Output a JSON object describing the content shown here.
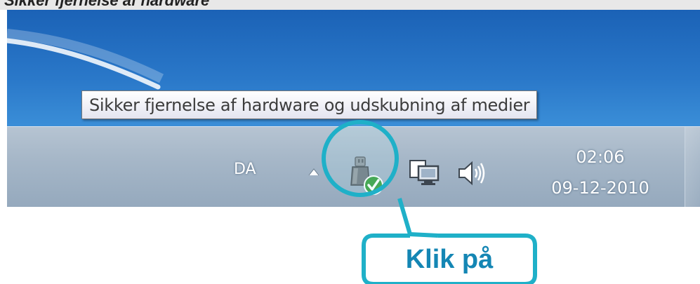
{
  "page_heading": "Sikker fjernelse af hardware",
  "tooltip": {
    "text": "Sikker fjernelse af hardware og udskubning af medier"
  },
  "taskbar": {
    "language": "DA",
    "clock": {
      "time": "02:06",
      "date": "09-12-2010"
    },
    "tray_icons": [
      "show-hidden-icons-arrow",
      "usb-safely-remove-icon",
      "network-icon",
      "volume-icon"
    ]
  },
  "callout": {
    "label": "Klik på",
    "color": "#1fb0c8"
  },
  "colors": {
    "desktop_blue": "#2a78c9",
    "taskbar": "#a6b7c8",
    "callout_text": "#1486b4"
  }
}
